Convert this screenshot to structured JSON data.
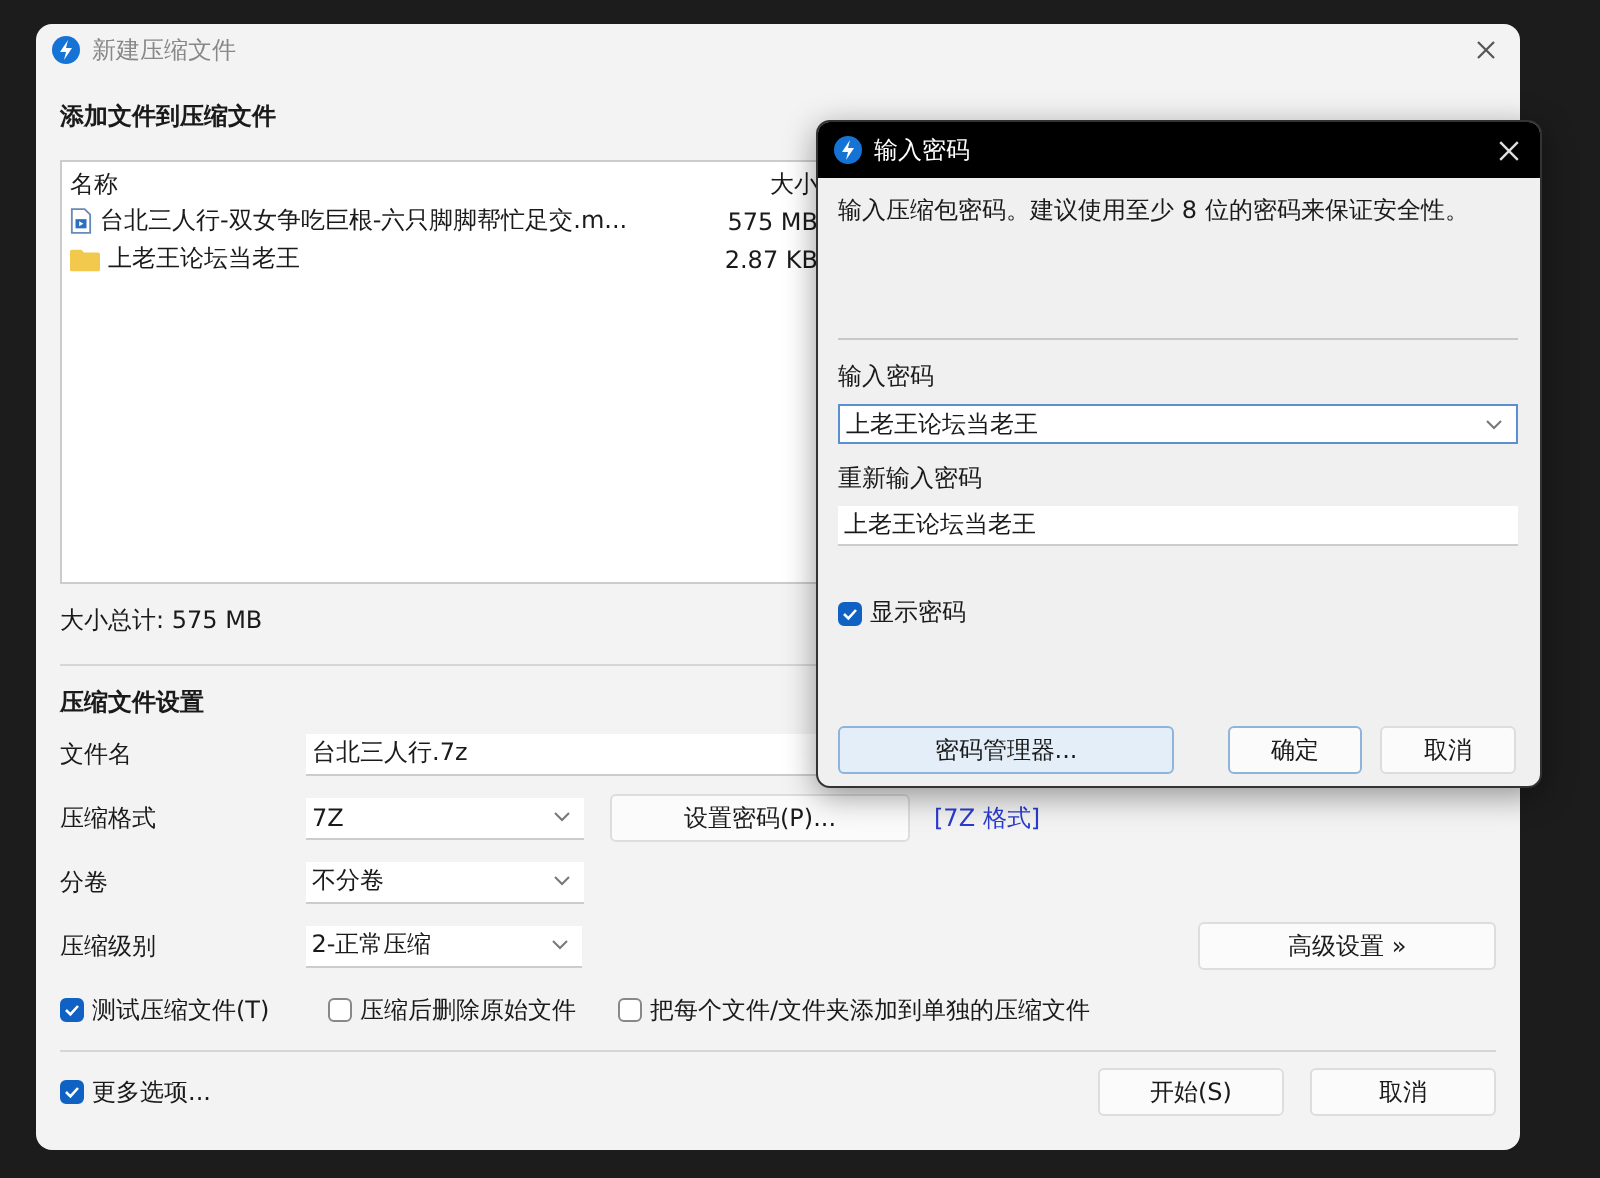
{
  "window": {
    "title": "新建压缩文件"
  },
  "files_section": {
    "heading": "添加文件到压缩文件",
    "columns": [
      "名称",
      "大小"
    ],
    "rows": [
      {
        "kind": "video",
        "name": "台北三人行-双女争吃巨根-六只脚脚帮忙足交.m...",
        "size": "575 MB"
      },
      {
        "kind": "folder",
        "name": "上老王论坛当老王",
        "size": "2.87 KB"
      }
    ],
    "total": "大小总计: 575 MB"
  },
  "settings": {
    "heading": "压缩文件设置",
    "filename_label": "文件名",
    "filename": "台北三人行.7z",
    "format_label": "压缩格式",
    "format": "7Z",
    "password_button": "设置密码(P)...",
    "format_link": "[7Z 格式]",
    "split_label": "分卷",
    "split": "不分卷",
    "level_label": "压缩级别",
    "level_value": "2-正常压缩",
    "advanced_button": "高级设置 »",
    "options": [
      {
        "label": "测试压缩文件(T)",
        "checked": true
      },
      {
        "label": "压缩后删除原始文件",
        "checked": false
      },
      {
        "label": "把每个文件/文件夹添加到单独的压缩文件",
        "checked": false
      }
    ]
  },
  "more_options": {
    "label": "更多选项...",
    "checked": true
  },
  "buttons": [
    "开始(S)",
    "取消"
  ],
  "password_dialog": {
    "title": "输入密码",
    "description": "输入压缩包密码。建议使用至少 8 位的密码来保证安全性。",
    "password_label": "输入密码",
    "password": "上老王论坛当老王",
    "repeat_label": "重新输入密码",
    "repeat": "上老王论坛当老王",
    "show_password": {
      "label": "显示密码",
      "checked": true
    },
    "manager_button": "密码管理器...",
    "ok_button": "确定",
    "cancel_button": "取消"
  }
}
